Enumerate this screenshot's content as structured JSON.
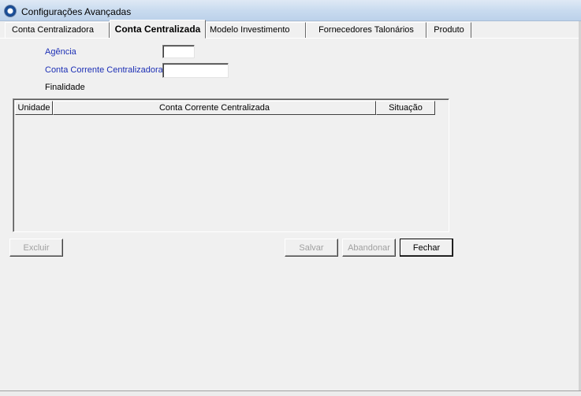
{
  "window": {
    "title": "Configurações Avançadas"
  },
  "tabs": [
    {
      "label": "Conta Centralizadora"
    },
    {
      "label": "Conta Centralizada"
    },
    {
      "label": "Modelo Investimento"
    },
    {
      "label": "Fornecedores Talonários"
    },
    {
      "label": "Produto"
    }
  ],
  "active_tab": "Conta Centralizada",
  "form": {
    "agencia_label": "Agência",
    "agencia_value": "",
    "conta_corrente_label": "Conta Corrente Centralizadora",
    "conta_corrente_value": "",
    "finalidade_label": "Finalidade"
  },
  "grid": {
    "columns": [
      "Unidade",
      "Conta Corrente Centralizada",
      "Situação"
    ],
    "rows": []
  },
  "buttons": {
    "excluir": "Excluir",
    "salvar": "Salvar",
    "abandonar": "Abandonar",
    "fechar": "Fechar"
  },
  "colors": {
    "label_blue": "#1c2fb5",
    "disabled_text": "#a0a0a0"
  }
}
